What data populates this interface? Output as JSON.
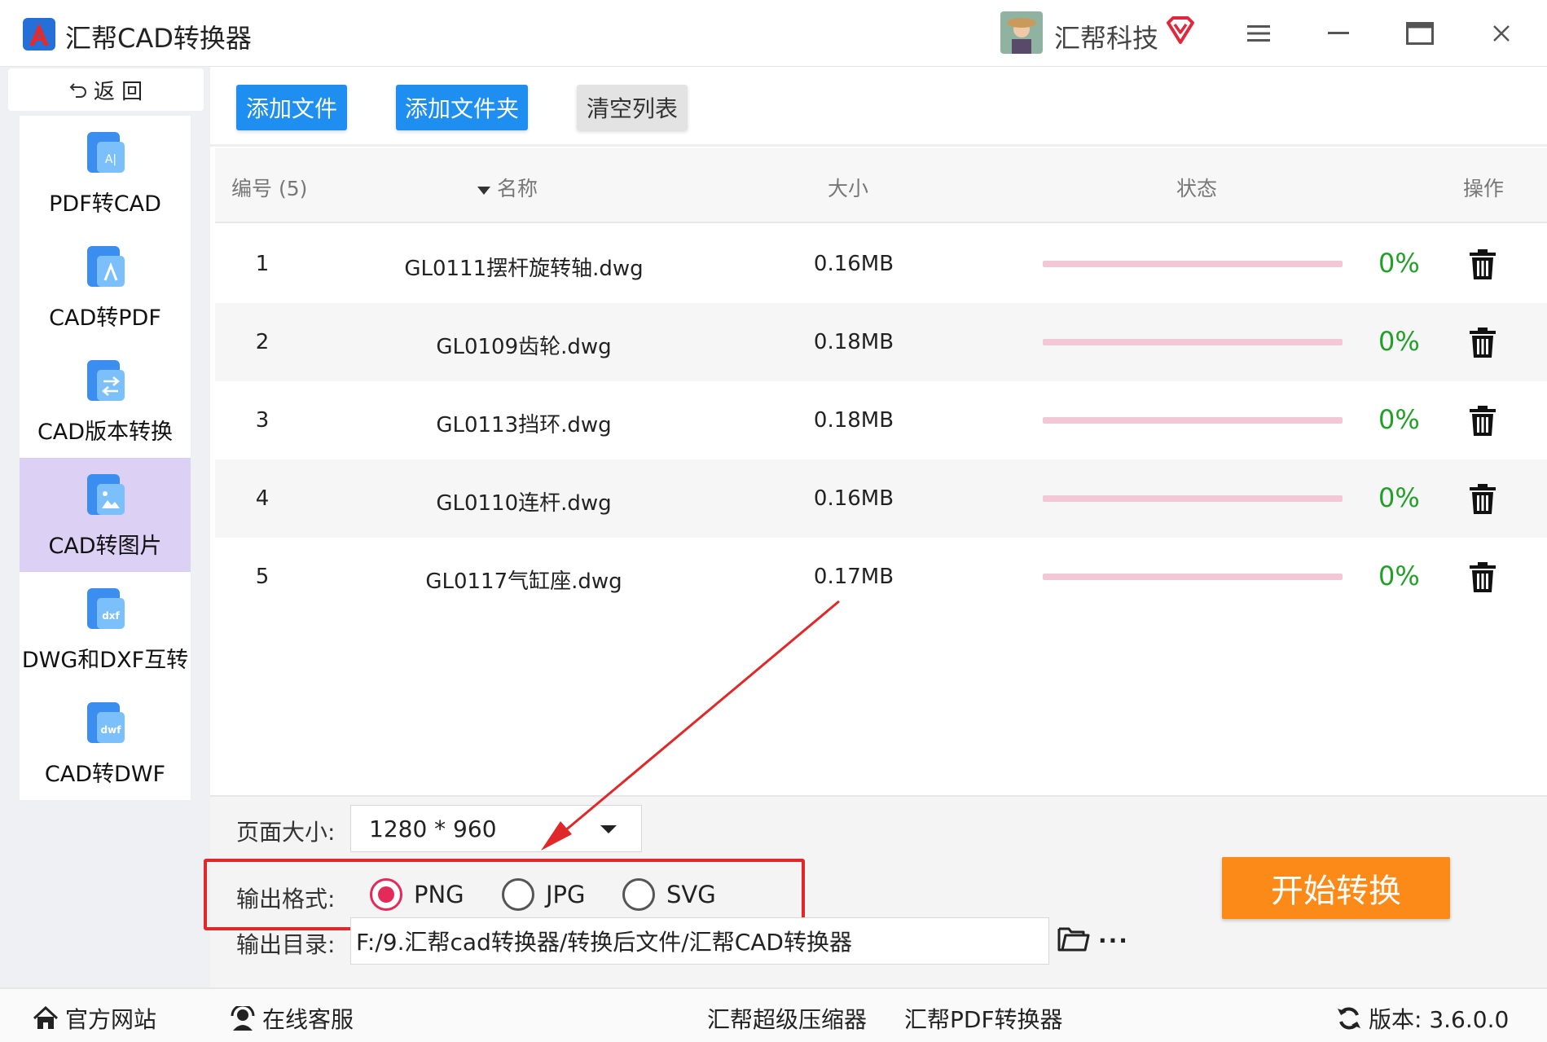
{
  "app": {
    "title": "汇帮CAD转换器"
  },
  "user": {
    "name": "汇帮科技"
  },
  "sidebar": {
    "back_label": "返 回",
    "items": [
      {
        "label": "PDF转CAD",
        "icon": "pdf-to-cad-icon"
      },
      {
        "label": "CAD转PDF",
        "icon": "cad-to-pdf-icon"
      },
      {
        "label": "CAD版本转换",
        "icon": "cad-version-icon"
      },
      {
        "label": "CAD转图片",
        "icon": "cad-to-image-icon",
        "active": true
      },
      {
        "label": "DWG和DXF互转",
        "icon": "dwg-dxf-icon"
      },
      {
        "label": "CAD转DWF",
        "icon": "cad-to-dwf-icon"
      }
    ]
  },
  "toolbar": {
    "add_file": "添加文件",
    "add_folder": "添加文件夹",
    "clear_list": "清空列表"
  },
  "table": {
    "headers": {
      "index": "编号 (5)",
      "name": "名称",
      "size": "大小",
      "status": "状态",
      "action": "操作"
    },
    "rows": [
      {
        "index": "1",
        "name": "GL0111摆杆旋转轴.dwg",
        "size": "0.16MB",
        "progress": "0%",
        "progress_value": 0
      },
      {
        "index": "2",
        "name": "GL0109齿轮.dwg",
        "size": "0.18MB",
        "progress": "0%",
        "progress_value": 0
      },
      {
        "index": "3",
        "name": "GL0113挡环.dwg",
        "size": "0.18MB",
        "progress": "0%",
        "progress_value": 0
      },
      {
        "index": "4",
        "name": "GL0110连杆.dwg",
        "size": "0.16MB",
        "progress": "0%",
        "progress_value": 0
      },
      {
        "index": "5",
        "name": "GL0117气缸座.dwg",
        "size": "0.17MB",
        "progress": "0%",
        "progress_value": 0
      }
    ]
  },
  "settings": {
    "page_size_label": "页面大小:",
    "page_size_value": "1280 * 960",
    "output_format_label": "输出格式:",
    "formats": [
      {
        "label": "PNG",
        "selected": true
      },
      {
        "label": "JPG",
        "selected": false
      },
      {
        "label": "SVG",
        "selected": false
      }
    ],
    "output_dir_label": "输出目录:",
    "output_dir_value": "F:/9.汇帮cad转换器/转换后文件/汇帮CAD转换器",
    "more_label": "···",
    "start_button": "开始转换"
  },
  "footer": {
    "website": "官方网站",
    "support": "在线客服",
    "compressor": "汇帮超级压缩器",
    "pdf_converter": "汇帮PDF转换器",
    "version": "版本: 3.6.0.0"
  },
  "colors": {
    "primary_blue": "#1e8ef0",
    "start_orange": "#fb8a19",
    "progress_green": "#22a02a",
    "radio_selected": "#e42a58",
    "annotation_red": "#e02828",
    "sidebar_active": "#dcd0f5"
  }
}
